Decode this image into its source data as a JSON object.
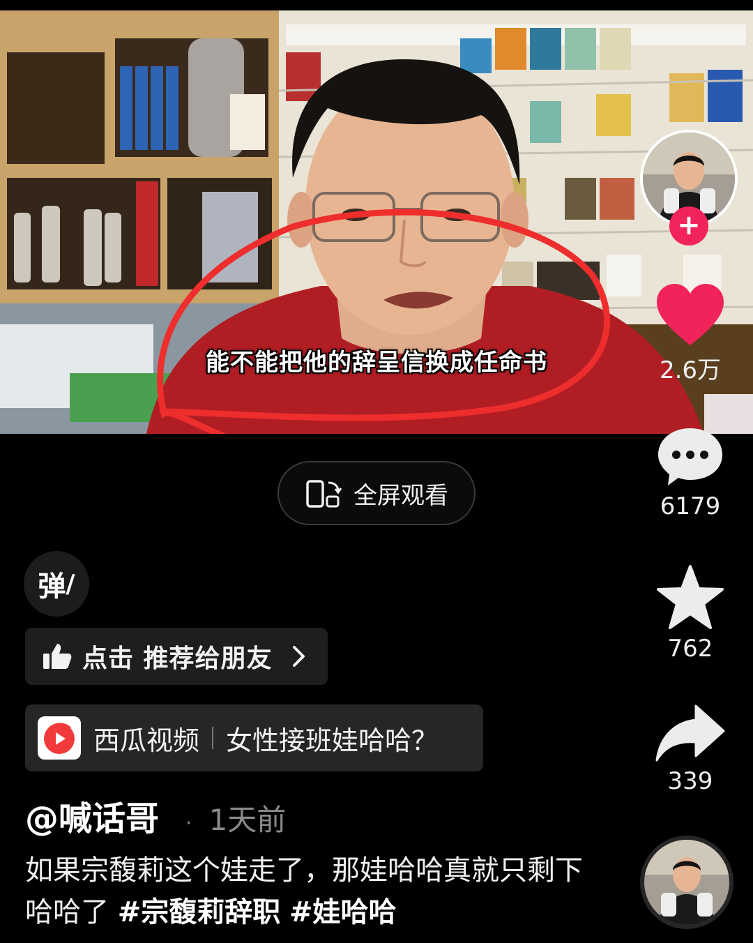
{
  "video": {
    "subtitle": "能不能把他的辞呈信换成任命书"
  },
  "fullscreen": {
    "label": "全屏观看",
    "icon": "fullscreen-rotate-icon"
  },
  "rail": {
    "like_count": "2.6万",
    "comment_count": "6179",
    "favorite_count": "762",
    "share_count": "339",
    "follow_symbol": "+",
    "accent_color": "#f0245a"
  },
  "danmu": {
    "label": "弹"
  },
  "recommend": {
    "label": "点击 推荐给朋友",
    "icon": "thumbs-up-icon"
  },
  "xigua": {
    "app_name": "西瓜视频",
    "topic": "女性接班娃哈哈？",
    "icon": "xigua-logo-icon"
  },
  "author": {
    "name": "@喊话哥",
    "time": "1天前"
  },
  "description": {
    "text": "如果宗馥莉这个娃走了，那娃哈哈真就只剩下哈哈了",
    "tags": [
      "#宗馥莉辞职",
      "#娃哈哈"
    ]
  }
}
